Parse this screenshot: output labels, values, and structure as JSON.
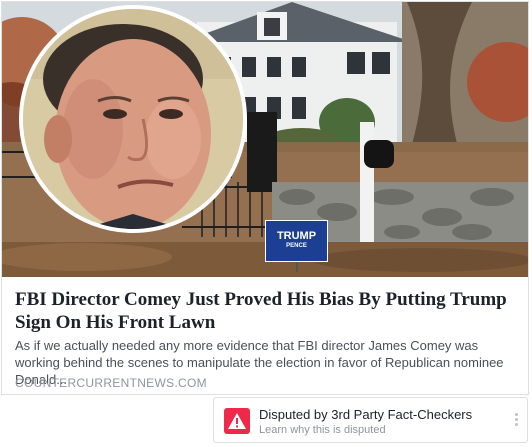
{
  "article": {
    "headline": "FBI Director Comey Just Proved His Bias By Putting Trump Sign On His Front Lawn",
    "description": "As if we actually needed any more evidence that FBI director James Comey was working behind the scenes to manipulate the election in favor of Republican nominee Donald...",
    "domain": "COUNTERCURRENTNEWS.COM"
  },
  "yard_sign": {
    "line1": "TRUMP",
    "line2": "PENCE"
  },
  "dispute": {
    "title": "Disputed by 3rd Party Fact-Checkers",
    "subtitle": "Learn why this is disputed",
    "icon": "warning-icon",
    "color": "#f02849"
  },
  "colors": {
    "headline": "#1d2129",
    "description": "#4b4f56",
    "domain": "#90949c",
    "sign_blue": "#1c3f94"
  }
}
